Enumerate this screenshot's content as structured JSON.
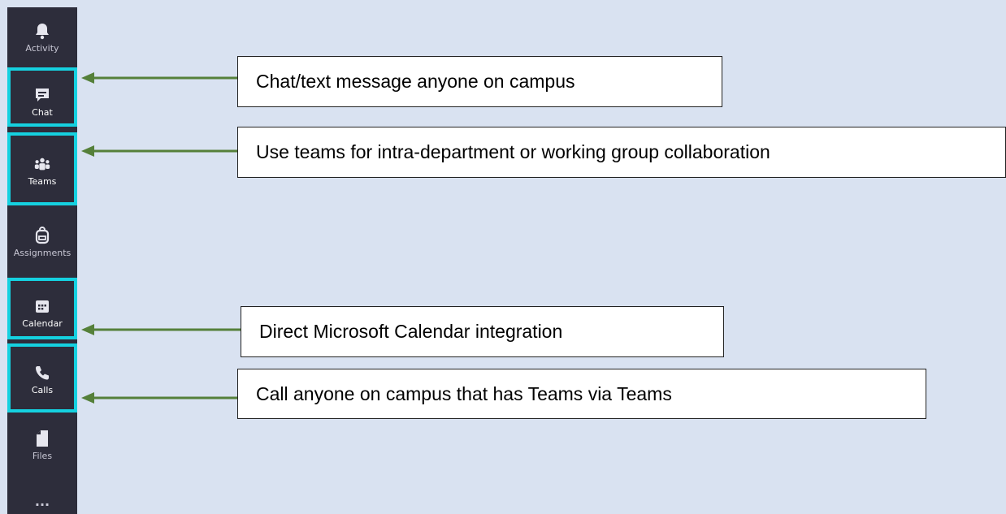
{
  "rail": {
    "items": [
      {
        "label": "Activity",
        "icon": "bell-icon"
      },
      {
        "label": "Chat",
        "icon": "chat-icon"
      },
      {
        "label": "Teams",
        "icon": "teams-icon"
      },
      {
        "label": "Assignments",
        "icon": "backpack-icon"
      },
      {
        "label": "Calendar",
        "icon": "calendar-icon"
      },
      {
        "label": "Calls",
        "icon": "phone-icon"
      },
      {
        "label": "Files",
        "icon": "file-icon"
      },
      {
        "label": "...",
        "icon": "more-icon"
      }
    ]
  },
  "callouts": {
    "chat": "Chat/text message anyone on campus",
    "teams": "Use teams for intra-department or working group collaboration",
    "calendar": "Direct Microsoft Calendar integration",
    "calls": "Call anyone on campus that has Teams via Teams"
  },
  "colors": {
    "background": "#d9e2f1",
    "rail": "#2d2d3b",
    "highlight": "#15d1e0",
    "arrow": "#55803a"
  }
}
